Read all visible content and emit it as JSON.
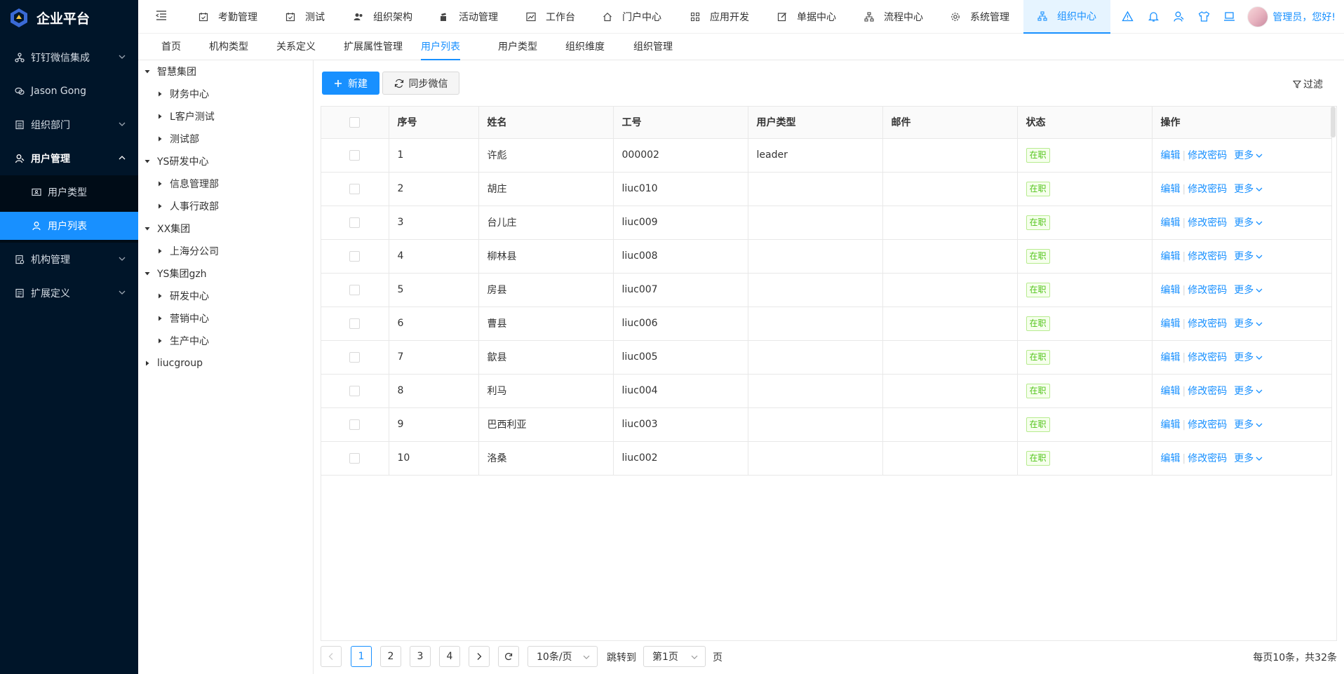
{
  "app": {
    "title": "企业平台"
  },
  "sidebar": {
    "items": [
      {
        "label": "钉钉微信集成",
        "icon": "integration-icon"
      },
      {
        "label": "Jason Gong",
        "icon": "wechat-icon"
      },
      {
        "label": "组织部门",
        "icon": "dept-icon"
      },
      {
        "label": "用户管理",
        "icon": "user-manage-icon"
      },
      {
        "label": "机构管理",
        "icon": "org-manage-icon"
      },
      {
        "label": "扩展定义",
        "icon": "extend-icon"
      }
    ],
    "subitems": [
      {
        "label": "用户类型",
        "icon": "id-card-icon"
      },
      {
        "label": "用户列表",
        "icon": "user-icon"
      }
    ]
  },
  "topnav": {
    "items": [
      "考勤管理",
      "测试",
      "组织架构",
      "活动管理",
      "工作台",
      "门户中心",
      "应用开发",
      "单据中心",
      "流程中心",
      "系统管理",
      "组织中心"
    ],
    "user_greeting": "管理员，您好!"
  },
  "subtabs": [
    "首页",
    "机构类型",
    "关系定义",
    "扩展属性管理",
    "用户列表",
    "用户类型",
    "组织维度",
    "组织管理"
  ],
  "tree": [
    {
      "label": "智慧集团"
    },
    {
      "label": "财务中心"
    },
    {
      "label": "L客户测试"
    },
    {
      "label": "测试部"
    },
    {
      "label": "YS研发中心"
    },
    {
      "label": "信息管理部"
    },
    {
      "label": "人事行政部"
    },
    {
      "label": "XX集团"
    },
    {
      "label": "上海分公司"
    },
    {
      "label": "YS集团gzh"
    },
    {
      "label": "研发中心"
    },
    {
      "label": "营销中心"
    },
    {
      "label": "生产中心"
    },
    {
      "label": "liucgroup"
    }
  ],
  "toolbar": {
    "new_label": "新建",
    "sync_label": "同步微信",
    "filter_label": "过滤"
  },
  "table": {
    "columns": [
      "序号",
      "姓名",
      "工号",
      "用户类型",
      "邮件",
      "状态",
      "操作"
    ],
    "rows": [
      {
        "no": "1",
        "name": "许彪",
        "code": "000002",
        "type": "leader",
        "email": "",
        "status": "在职"
      },
      {
        "no": "2",
        "name": "胡庄",
        "code": "liuc010",
        "type": "",
        "email": "",
        "status": "在职"
      },
      {
        "no": "3",
        "name": "台儿庄",
        "code": "liuc009",
        "type": "",
        "email": "",
        "status": "在职"
      },
      {
        "no": "4",
        "name": "柳林县",
        "code": "liuc008",
        "type": "",
        "email": "",
        "status": "在职"
      },
      {
        "no": "5",
        "name": "房县",
        "code": "liuc007",
        "type": "",
        "email": "",
        "status": "在职"
      },
      {
        "no": "6",
        "name": "曹县",
        "code": "liuc006",
        "type": "",
        "email": "",
        "status": "在职"
      },
      {
        "no": "7",
        "name": "歙县",
        "code": "liuc005",
        "type": "",
        "email": "",
        "status": "在职"
      },
      {
        "no": "8",
        "name": "利马",
        "code": "liuc004",
        "type": "",
        "email": "",
        "status": "在职"
      },
      {
        "no": "9",
        "name": "巴西利亚",
        "code": "liuc003",
        "type": "",
        "email": "",
        "status": "在职"
      },
      {
        "no": "10",
        "name": "洛桑",
        "code": "liuc002",
        "type": "",
        "email": "",
        "status": "在职"
      }
    ],
    "ops": {
      "edit": "编辑",
      "change_pwd": "修改密码",
      "more": "更多"
    }
  },
  "pagination": {
    "pages": [
      "1",
      "2",
      "3",
      "4"
    ],
    "current": "1",
    "page_size": "10条/页",
    "jump_label": "跳转到",
    "jump_value": "第1页",
    "page_suffix": "页",
    "summary": "每页10条，共32条"
  },
  "colors": {
    "primary": "#1890ff",
    "sidebar": "#001529",
    "success": "#52c41a"
  }
}
